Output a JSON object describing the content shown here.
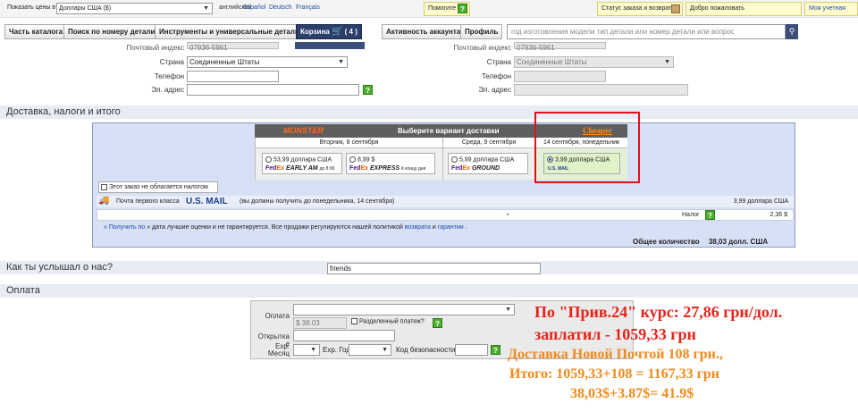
{
  "topbar": {
    "currency_label": "Показать цены в",
    "currency_value": "Доллары США ($)",
    "langs": [
      "английский",
      "Español",
      "Deutsch",
      "Français"
    ],
    "help": "Помогите",
    "order_status": "Статус заказа и возврат",
    "welcome": "Добро пожаловать",
    "account": "Моя учетная запис"
  },
  "nav": {
    "items": [
      "Часть каталога",
      "Поиск по номеру детали",
      "Инструменты и универсальные детали"
    ],
    "cart_label": "Корзина",
    "cart_count": "( 4 )",
    "account_activity": "Активность аккаунта",
    "profile": "Профиль",
    "search_placeholder": "год изготовления модели тип детали или номер детали или вопрос"
  },
  "address": {
    "postal_label": "Почтовый индекс",
    "postal_value": "07936-5961",
    "country_label": "Страна",
    "country_value": "Соединенные Штаты",
    "phone_label": "Телефон",
    "email_label": "Эл. адрес",
    "right_postal_label": "Почтовый индекс",
    "right_postal_value": "07936-5961",
    "right_country_label": "Страна",
    "right_country_value": "Соединенные Штаты",
    "right_phone_label": "Телефон",
    "right_email_label": "Эл. адрес"
  },
  "shipping_section": {
    "title": "Доставка, налоги и итого",
    "header_logo": "MONSTER",
    "header_title": "Выберите вариант доставки",
    "cheaper": "Cheaper",
    "cols": [
      {
        "date": "Вторник, 8 сентября",
        "options": [
          {
            "price": "53,99 доллара США",
            "carrier": "FedEx",
            "service": "EARLY AM",
            "note": "до 8:00"
          },
          {
            "price": "8,99 $",
            "carrier": "FedEx",
            "service": "EXPRESS",
            "note": "К концу дня"
          }
        ]
      },
      {
        "date": "Среда, 9 сентября",
        "options": [
          {
            "price": "5,99 доллара США",
            "carrier": "FedEx",
            "service": "GROUND",
            "note": ""
          }
        ]
      },
      {
        "date": "14 сентября, понедельник",
        "options": [
          {
            "price": "3,99 доллара США",
            "carrier": "U.S. MAIL",
            "service": "",
            "note": ""
          }
        ]
      }
    ],
    "tax_exempt": "Этот заказ не облагается налогом",
    "mail_class": "Почта первого класса",
    "mail_logo": "U.S. MAIL",
    "mail_eta": "(вы должны получить до понедельника, 14 сентября)",
    "mail_price": "3,99 доллара США",
    "tax_label": "Налог",
    "tax_value": "2,36 $",
    "disclaimer_link": "« Получить по",
    "disclaimer_text": "» дата лучшие оценки и не гарантируется. Все продажи регулируются нашей политикой",
    "returns_link": "возврата",
    "and": "и",
    "warranty_link": "гарантии",
    "total_label": "Общее количество",
    "total_value": "38,03 долл. США"
  },
  "heard": {
    "title": "Как ты услышал о нас?",
    "value": "friends"
  },
  "payment": {
    "title": "Оплата",
    "pay_label": "Оплата",
    "amount": "$ 38.03",
    "split": "Разделенный платеж?",
    "card_label": "Открытка #",
    "exp_label": "Exp. Месяц",
    "exp_year": "Exp. Год",
    "cvv_label": "Код безопасности"
  },
  "overlay": {
    "line1": "По \"Прив.24\" курс: 27,86 грн/дол.",
    "line2": "заплатил - 1059,33 грн",
    "line3": "Доставка Новой Почтой 108 грн.,",
    "line4": "Итого: 1059,33+108 = 1167,33 грн",
    "line5": "38,03$+3.87$= 41.9$"
  },
  "colors": {
    "accent": "#2a3f6a",
    "panel": "#d7e0f4",
    "highlight": "#e0101a",
    "overlay_red": "#e8231a",
    "overlay_orange": "#f08a1c"
  }
}
